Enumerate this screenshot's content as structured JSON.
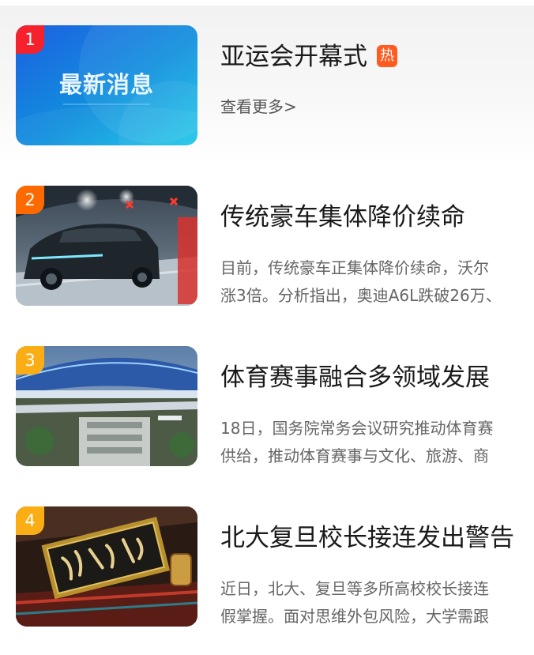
{
  "items": [
    {
      "rank": "1",
      "rank_color": "#f5222d",
      "title": "亚运会开幕式",
      "hot_badge": "热",
      "more_link": "查看更多>",
      "thumb_text": "最新消息"
    },
    {
      "rank": "2",
      "rank_color": "#ff6a00",
      "title": "传统豪车集体降价续命",
      "desc_lines": [
        "目前，传统豪车正集体降价续命，沃尔",
        "涨3倍。分析指出，奥迪A6L跌破26万、"
      ]
    },
    {
      "rank": "3",
      "rank_color": "#faad14",
      "title": "体育赛事融合多领域发展",
      "desc_lines": [
        "18日，国务院常务会议研究推动体育赛",
        "供给，推动体育赛事与文化、旅游、商"
      ]
    },
    {
      "rank": "4",
      "rank_color": "#faad14",
      "title": "北大复旦校长接连发出警告",
      "desc_lines": [
        "近日，北大、复旦等多所高校校长接连",
        "假掌握。面对思维外包风险，大学需跟"
      ]
    }
  ]
}
